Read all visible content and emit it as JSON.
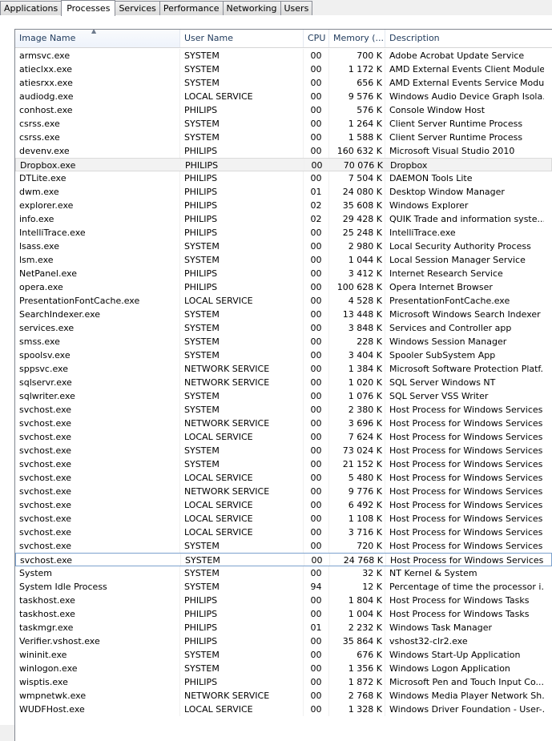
{
  "tabs": [
    "Applications",
    "Processes",
    "Services",
    "Performance",
    "Networking",
    "Users"
  ],
  "active_tab": "Processes",
  "columns": [
    "Image Name",
    "User Name",
    "CPU",
    "Memory (...",
    "Description"
  ],
  "sort_indicator": "▲",
  "processes": [
    [
      "armsvc.exe",
      "SYSTEM",
      "00",
      "700 K",
      "Adobe Acrobat Update Service"
    ],
    [
      "atieclxx.exe",
      "SYSTEM",
      "00",
      "1 172 K",
      "AMD External Events Client Module"
    ],
    [
      "atiesrxx.exe",
      "SYSTEM",
      "00",
      "656 K",
      "AMD External Events Service Module"
    ],
    [
      "audiodg.exe",
      "LOCAL SERVICE",
      "00",
      "9 576 K",
      "Windows Audio Device Graph Isola..."
    ],
    [
      "conhost.exe",
      "PHILIPS",
      "00",
      "576 K",
      "Console Window Host"
    ],
    [
      "csrss.exe",
      "SYSTEM",
      "00",
      "1 264 K",
      "Client Server Runtime Process"
    ],
    [
      "csrss.exe",
      "SYSTEM",
      "00",
      "1 588 K",
      "Client Server Runtime Process"
    ],
    [
      "devenv.exe",
      "PHILIPS",
      "00",
      "160 632 K",
      "Microsoft Visual Studio 2010"
    ],
    [
      "Dropbox.exe",
      "PHILIPS",
      "00",
      "70 076 K",
      "Dropbox"
    ],
    [
      "DTLite.exe",
      "PHILIPS",
      "00",
      "7 504 K",
      "DAEMON Tools Lite"
    ],
    [
      "dwm.exe",
      "PHILIPS",
      "01",
      "24 080 K",
      "Desktop Window Manager"
    ],
    [
      "explorer.exe",
      "PHILIPS",
      "02",
      "35 608 K",
      "Windows Explorer"
    ],
    [
      "info.exe",
      "PHILIPS",
      "02",
      "29 428 K",
      "QUIK Trade and information syste..."
    ],
    [
      "IntelliTrace.exe",
      "PHILIPS",
      "00",
      "25 248 K",
      "IntelliTrace.exe"
    ],
    [
      "lsass.exe",
      "SYSTEM",
      "00",
      "2 980 K",
      "Local Security Authority Process"
    ],
    [
      "lsm.exe",
      "SYSTEM",
      "00",
      "1 044 K",
      "Local Session Manager Service"
    ],
    [
      "NetPanel.exe",
      "PHILIPS",
      "00",
      "3 412 K",
      "Internet Research Service"
    ],
    [
      "opera.exe",
      "PHILIPS",
      "00",
      "100 628 K",
      "Opera Internet Browser"
    ],
    [
      "PresentationFontCache.exe",
      "LOCAL SERVICE",
      "00",
      "4 528 K",
      "PresentationFontCache.exe"
    ],
    [
      "SearchIndexer.exe",
      "SYSTEM",
      "00",
      "13 448 K",
      "Microsoft Windows Search Indexer"
    ],
    [
      "services.exe",
      "SYSTEM",
      "00",
      "3 848 K",
      "Services and Controller app"
    ],
    [
      "smss.exe",
      "SYSTEM",
      "00",
      "228 K",
      "Windows Session Manager"
    ],
    [
      "spoolsv.exe",
      "SYSTEM",
      "00",
      "3 404 K",
      "Spooler SubSystem App"
    ],
    [
      "sppsvc.exe",
      "NETWORK SERVICE",
      "00",
      "1 384 K",
      "Microsoft Software Protection Platf..."
    ],
    [
      "sqlservr.exe",
      "NETWORK SERVICE",
      "00",
      "1 020 K",
      "SQL Server Windows NT"
    ],
    [
      "sqlwriter.exe",
      "SYSTEM",
      "00",
      "1 076 K",
      "SQL Server VSS Writer"
    ],
    [
      "svchost.exe",
      "SYSTEM",
      "00",
      "2 380 K",
      "Host Process for Windows Services"
    ],
    [
      "svchost.exe",
      "NETWORK SERVICE",
      "00",
      "3 696 K",
      "Host Process for Windows Services"
    ],
    [
      "svchost.exe",
      "LOCAL SERVICE",
      "00",
      "7 624 K",
      "Host Process for Windows Services"
    ],
    [
      "svchost.exe",
      "SYSTEM",
      "00",
      "73 024 K",
      "Host Process for Windows Services"
    ],
    [
      "svchost.exe",
      "SYSTEM",
      "00",
      "21 152 K",
      "Host Process for Windows Services"
    ],
    [
      "svchost.exe",
      "LOCAL SERVICE",
      "00",
      "5 480 K",
      "Host Process for Windows Services"
    ],
    [
      "svchost.exe",
      "NETWORK SERVICE",
      "00",
      "9 776 K",
      "Host Process for Windows Services"
    ],
    [
      "svchost.exe",
      "LOCAL SERVICE",
      "00",
      "6 492 K",
      "Host Process for Windows Services"
    ],
    [
      "svchost.exe",
      "LOCAL SERVICE",
      "00",
      "1 108 K",
      "Host Process for Windows Services"
    ],
    [
      "svchost.exe",
      "LOCAL SERVICE",
      "00",
      "3 716 K",
      "Host Process for Windows Services"
    ],
    [
      "svchost.exe",
      "SYSTEM",
      "00",
      "720 K",
      "Host Process for Windows Services"
    ],
    [
      "svchost.exe",
      "SYSTEM",
      "00",
      "24 768 K",
      "Host Process for Windows Services"
    ],
    [
      "System",
      "SYSTEM",
      "00",
      "32 K",
      "NT Kernel & System"
    ],
    [
      "System Idle Process",
      "SYSTEM",
      "94",
      "12 K",
      "Percentage of time the processor i..."
    ],
    [
      "taskhost.exe",
      "PHILIPS",
      "00",
      "1 804 K",
      "Host Process for Windows Tasks"
    ],
    [
      "taskhost.exe",
      "PHILIPS",
      "00",
      "1 004 K",
      "Host Process for Windows Tasks"
    ],
    [
      "taskmgr.exe",
      "PHILIPS",
      "01",
      "2 232 K",
      "Windows Task Manager"
    ],
    [
      "Verifier.vshost.exe",
      "PHILIPS",
      "00",
      "35 864 K",
      "vshost32-clr2.exe"
    ],
    [
      "wininit.exe",
      "SYSTEM",
      "00",
      "676 K",
      "Windows Start-Up Application"
    ],
    [
      "winlogon.exe",
      "SYSTEM",
      "00",
      "1 356 K",
      "Windows Logon Application"
    ],
    [
      "wisptis.exe",
      "PHILIPS",
      "00",
      "1 872 K",
      "Microsoft Pen and Touch Input Co..."
    ],
    [
      "wmpnetwk.exe",
      "NETWORK SERVICE",
      "00",
      "2 768 K",
      "Windows Media Player Network Sh..."
    ],
    [
      "WUDFHost.exe",
      "LOCAL SERVICE",
      "00",
      "1 328 K",
      "Windows Driver Foundation - User-..."
    ]
  ],
  "highlighted_row": 8,
  "focused_row": 37
}
